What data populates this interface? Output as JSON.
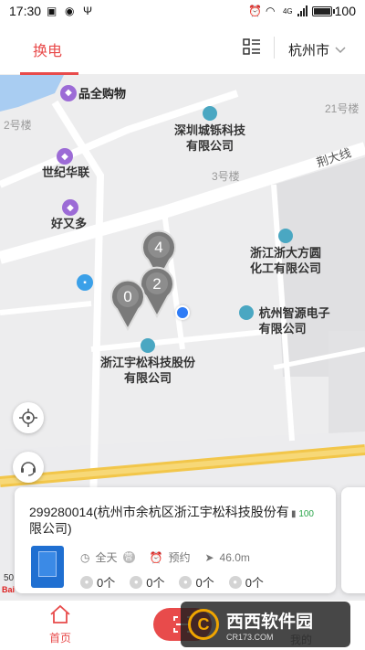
{
  "status_bar": {
    "time": "17:30",
    "battery": "100",
    "network": "4G",
    "battery_level": 1.0
  },
  "header": {
    "tab_label": "换电",
    "city": "杭州市",
    "accent": "#e84b4b"
  },
  "map": {
    "pois": {
      "pinquan": "品全购物",
      "shiji": "世纪华联",
      "haoyouduo": "好又多",
      "shenzhen": "深圳城铄科技\n有限公司",
      "zheda": "浙江浙大方圆\n化工有限公司",
      "zhiyuan": "杭州智源电子\n有限公司",
      "yusong": "浙江宇松科技股份\n有限公司"
    },
    "buildings": {
      "b2": "2号楼",
      "b3": "3号楼",
      "b21": "21号楼"
    },
    "road": "荆大线",
    "pins": {
      "top": "4",
      "mid": "2",
      "left": "0"
    },
    "scale": "50",
    "map_logo": "Bai"
  },
  "card": {
    "title": "299280014(杭州市余杭区浙江宇松科技股份有限公司)",
    "battery_badge": "100",
    "hours": "全天",
    "reserve": "预约",
    "distance": "46.0m",
    "counts": [
      "0个",
      "0个",
      "0个",
      "0个"
    ]
  },
  "bottom_nav": {
    "home": "首页",
    "mine": "我的"
  },
  "watermark": {
    "brand": "西西软件园",
    "site": "CR173.COM"
  }
}
